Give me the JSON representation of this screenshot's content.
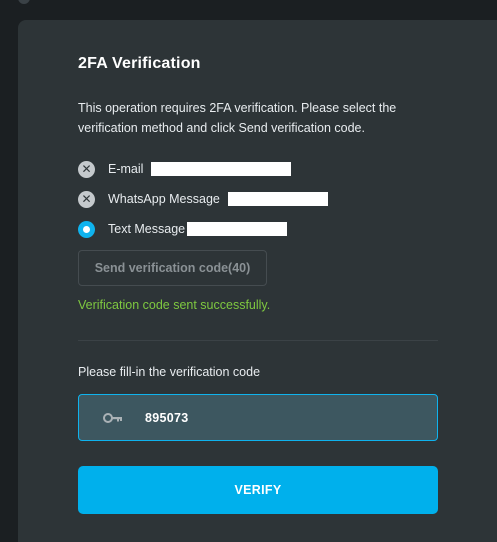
{
  "dialog": {
    "title": "2FA Verification",
    "description": "This operation requires 2FA verification. Please select the verification method and click Send verification code."
  },
  "methods": [
    {
      "label": "E-mail",
      "selected": false,
      "icon": "x-icon"
    },
    {
      "label": "WhatsApp Message",
      "selected": false,
      "icon": "x-icon"
    },
    {
      "label": "Text Message",
      "selected": true,
      "icon": "radio-selected-icon"
    }
  ],
  "send_button": {
    "label": "Send verification code(40)",
    "disabled": true
  },
  "status": {
    "message": "Verification code sent successfully.",
    "color": "#7ec840"
  },
  "code_input": {
    "label": "Please fill-in the verification code",
    "value": "895073",
    "icon": "key-icon"
  },
  "verify_button": {
    "label": "VERIFY"
  },
  "colors": {
    "accent": "#00b0ec",
    "background": "#1b1f22",
    "card": "#2d3437",
    "success": "#7ec840"
  }
}
